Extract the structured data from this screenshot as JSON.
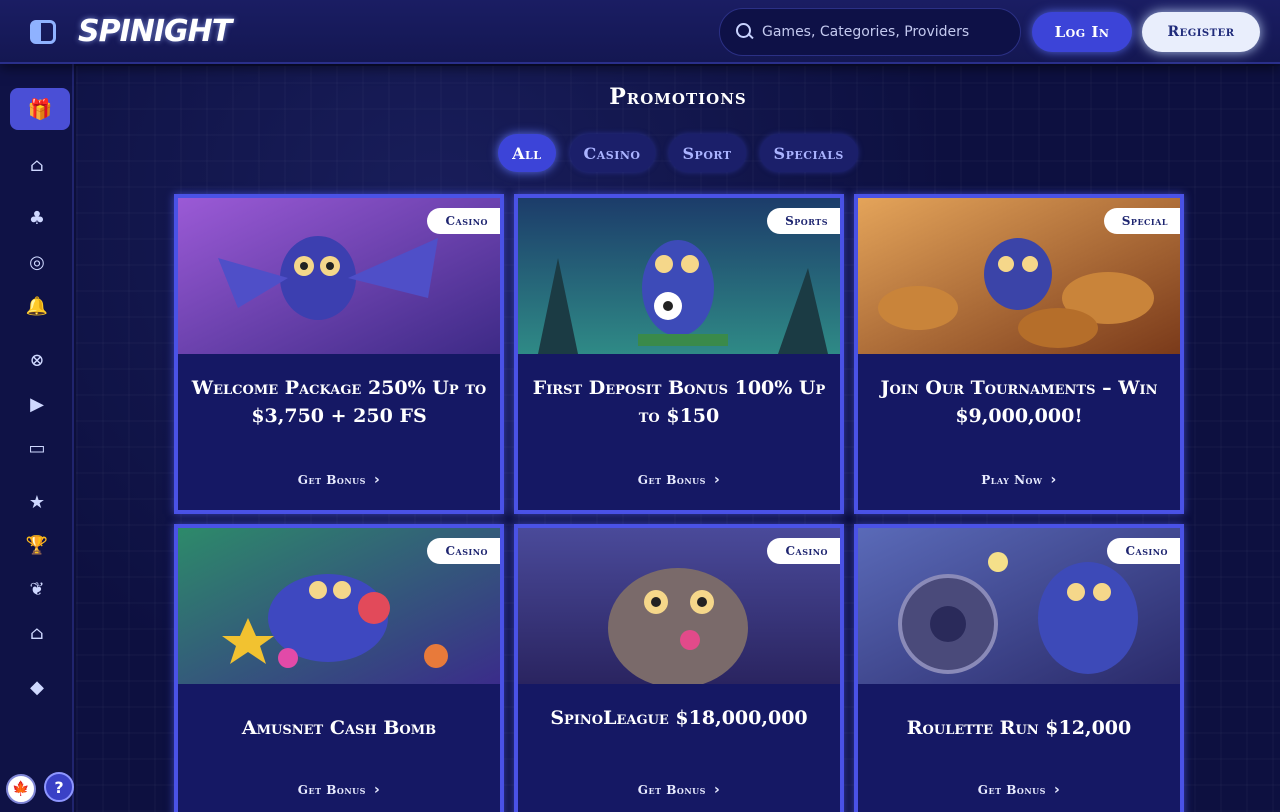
{
  "header": {
    "logo": "SPINIGHT",
    "search_placeholder": "Games, Categories, Providers",
    "login_label": "Log In",
    "register_label": "Register"
  },
  "sidebar": {
    "items": [
      {
        "icon": "gift-icon",
        "glyph": "🎁"
      },
      {
        "icon": "home-icon",
        "glyph": "⌂"
      },
      {
        "icon": "clubs-icon",
        "glyph": "♣"
      },
      {
        "icon": "roulette-icon",
        "glyph": "◎"
      },
      {
        "icon": "bell-icon",
        "glyph": "🔔"
      },
      {
        "icon": "basketball-icon",
        "glyph": "⊗"
      },
      {
        "icon": "play-icon",
        "glyph": "▶"
      },
      {
        "icon": "monitor-icon",
        "glyph": "▭"
      },
      {
        "icon": "star-shield-icon",
        "glyph": "★"
      },
      {
        "icon": "trophy-icon",
        "glyph": "🏆"
      },
      {
        "icon": "wing-icon",
        "glyph": "❦"
      },
      {
        "icon": "shop-icon",
        "glyph": "⌂"
      },
      {
        "icon": "diamond-icon",
        "glyph": "◆"
      }
    ],
    "flag": "🍁",
    "help": "?"
  },
  "main": {
    "title": "Promotions",
    "tabs": [
      {
        "label": "All",
        "active": true
      },
      {
        "label": "Casino",
        "active": false
      },
      {
        "label": "Sport",
        "active": false
      },
      {
        "label": "Specials",
        "active": false
      }
    ],
    "cards": [
      {
        "tag": "Casino",
        "title": "Welcome Package 250% Up to $3,750 + 250 FS",
        "cta": "Get Bonus",
        "theme": "#7b3fb8"
      },
      {
        "tag": "Sports",
        "title": "First Deposit Bonus 100% Up to $150",
        "cta": "Get Bonus",
        "theme": "#1e6a7a"
      },
      {
        "tag": "Special",
        "title": "Join Our Tournaments – Win $9,000,000!",
        "cta": "Play Now",
        "theme": "#b4652a"
      },
      {
        "tag": "Casino",
        "title": "Amusnet Cash Bomb",
        "cta": "Get Bonus",
        "theme": "#3b3a9a"
      },
      {
        "tag": "Casino",
        "title": "SpinoLeague $18,000,000",
        "cta": "Get Bonus",
        "theme": "#5a4a8a"
      },
      {
        "tag": "Casino",
        "title": "Roulette Run $12,000",
        "cta": "Get Bonus",
        "theme": "#3d4a9e"
      }
    ]
  }
}
